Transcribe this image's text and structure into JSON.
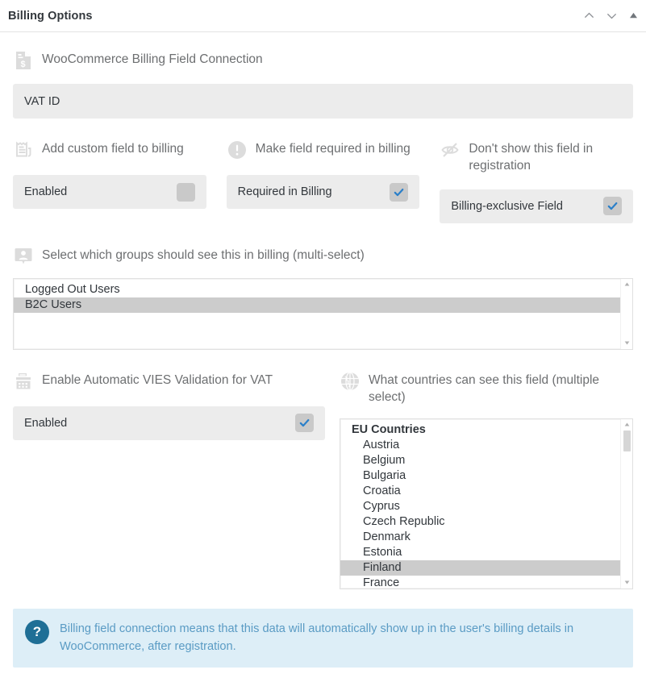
{
  "header": {
    "title": "Billing Options",
    "controls": [
      {
        "name": "move-up-icon",
        "glyph": "chevron-up"
      },
      {
        "name": "move-down-icon",
        "glyph": "chevron-down"
      },
      {
        "name": "collapse-toggle-icon",
        "glyph": "triangle-up"
      }
    ]
  },
  "fields": {
    "woo_connection": {
      "icon": "invoice-dollar-icon",
      "label": "WooCommerce Billing Field Connection",
      "value": "VAT ID"
    },
    "add_custom_field": {
      "icon": "receipt-icon",
      "label": "Add custom field to billing",
      "checkbox_label": "Enabled",
      "checked": false
    },
    "make_required": {
      "icon": "exclamation-circle-icon",
      "label": "Make field required in billing",
      "checkbox_label": "Required in Billing",
      "checked": true
    },
    "hide_in_registration": {
      "icon": "eye-slash-icon",
      "label": "Don't show this field in registration",
      "checkbox_label": "Billing-exclusive Field",
      "checked": true
    },
    "groups_select": {
      "icon": "user-badge-icon",
      "label": "Select which groups should see this in billing (multi-select)",
      "options": [
        {
          "text": "Logged Out Users",
          "selected": false,
          "group": false
        },
        {
          "text": "B2C Users",
          "selected": true,
          "group": false
        }
      ]
    },
    "vies_validation": {
      "icon": "cash-register-icon",
      "label": "Enable Automatic VIES Validation for VAT",
      "checkbox_label": "Enabled",
      "checked": true
    },
    "countries_select": {
      "icon": "globe-icon",
      "label": "What countries can see this field (multiple select)",
      "options": [
        {
          "text": "EU Countries",
          "selected": false,
          "group": true
        },
        {
          "text": "Austria",
          "selected": false,
          "group": false
        },
        {
          "text": "Belgium",
          "selected": false,
          "group": false
        },
        {
          "text": "Bulgaria",
          "selected": false,
          "group": false
        },
        {
          "text": "Croatia",
          "selected": false,
          "group": false
        },
        {
          "text": "Cyprus",
          "selected": false,
          "group": false
        },
        {
          "text": "Czech Republic",
          "selected": false,
          "group": false
        },
        {
          "text": "Denmark",
          "selected": false,
          "group": false
        },
        {
          "text": "Estonia",
          "selected": false,
          "group": false
        },
        {
          "text": "Finland",
          "selected": true,
          "group": false
        },
        {
          "text": "France",
          "selected": false,
          "group": false
        }
      ]
    }
  },
  "notice": {
    "icon": "question-mark-icon",
    "glyph": "?",
    "text": "Billing field connection means that this data will automatically show up in the user's billing details in WooCommerce, after registration."
  },
  "colors": {
    "accent_blue": "#2a7fc9",
    "notice_bg": "#ddeef7",
    "notice_text": "#5a9bc4",
    "grey_box": "#ececec",
    "label_text": "#6d6f71"
  }
}
